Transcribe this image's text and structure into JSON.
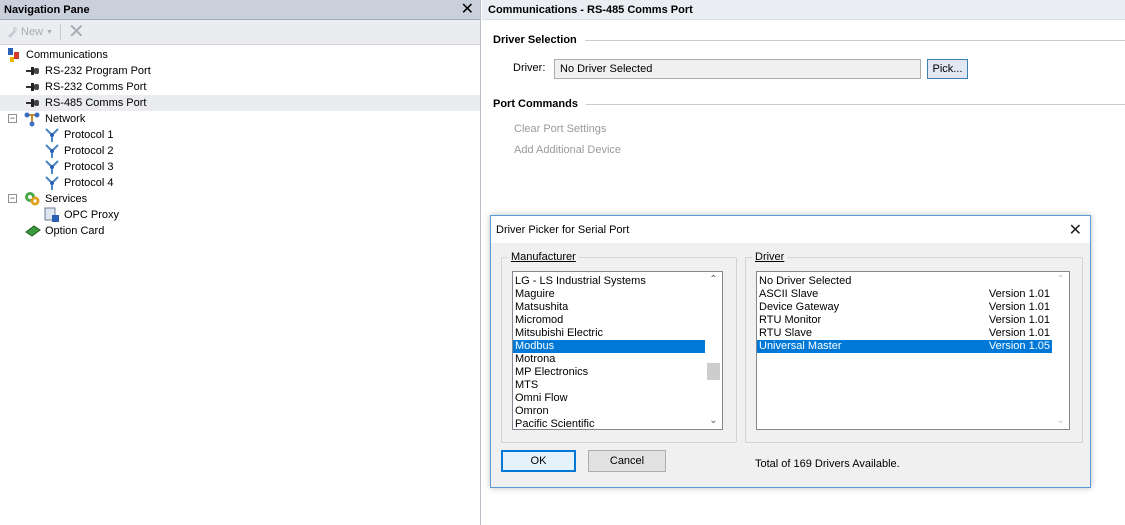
{
  "nav": {
    "title": "Navigation Pane",
    "close_glyph": "✕",
    "toolbar": {
      "new_label": "New",
      "new_icon": "new-item-icon",
      "delete_icon": "delete-icon"
    },
    "tree": {
      "communications": "Communications",
      "rs232_program": "RS-232 Program Port",
      "rs232_comms": "RS-232 Comms Port",
      "rs485_comms": "RS-485 Comms Port",
      "network": "Network",
      "protocol1": "Protocol 1",
      "protocol2": "Protocol 2",
      "protocol3": "Protocol 3",
      "protocol4": "Protocol 4",
      "services": "Services",
      "opc_proxy": "OPC Proxy",
      "option_card": "Option Card"
    }
  },
  "main": {
    "title": "Communications - RS-485 Comms Port",
    "driver_selection": {
      "heading": "Driver Selection",
      "label": "Driver:",
      "value": "No Driver Selected",
      "pick_label": "Pick..."
    },
    "port_commands": {
      "heading": "Port Commands",
      "clear": "Clear Port Settings",
      "add": "Add Additional Device"
    }
  },
  "dialog": {
    "title": "Driver Picker for Serial Port",
    "close_glyph": "✕",
    "manufacturer": {
      "legend": "Manufacturer",
      "items": [
        "LG - LS Industrial Systems",
        "Maguire",
        "Matsushita",
        "Micromod",
        "Mitsubishi Electric",
        "Modbus",
        "Motrona",
        "MP Electronics",
        "MTS",
        "Omni Flow",
        "Omron",
        "Pacific Scientific"
      ],
      "selected_index": 5
    },
    "driver": {
      "legend": "Driver",
      "items": [
        {
          "name": "No Driver Selected",
          "version": ""
        },
        {
          "name": "ASCII Slave",
          "version": "Version 1.01"
        },
        {
          "name": "Device Gateway",
          "version": "Version 1.01"
        },
        {
          "name": "RTU Monitor",
          "version": "Version 1.01"
        },
        {
          "name": "RTU Slave",
          "version": "Version 1.01"
        },
        {
          "name": "Universal Master",
          "version": "Version 1.05"
        }
      ],
      "selected_index": 5
    },
    "ok_label": "OK",
    "cancel_label": "Cancel",
    "total_text": "Total of 169 Drivers Available."
  },
  "colors": {
    "selection": "#0078d7",
    "nav_titlebar": "#c9cfdb",
    "dialog_border": "#5c9ad6"
  }
}
